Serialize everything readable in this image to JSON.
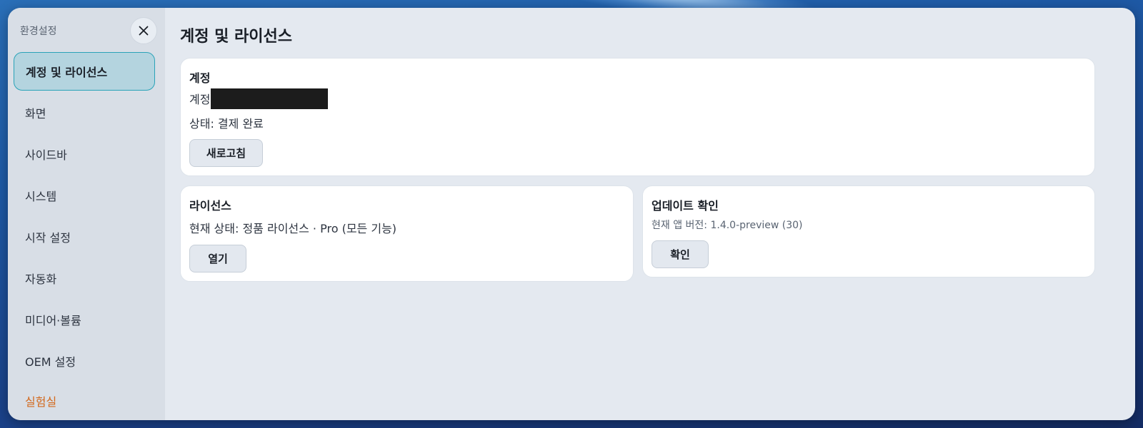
{
  "sidebar": {
    "title": "환경설정",
    "items": [
      {
        "label": "계정 및 라이선스",
        "active": true
      },
      {
        "label": "화면"
      },
      {
        "label": "사이드바"
      },
      {
        "label": "시스템"
      },
      {
        "label": "시작 설정"
      },
      {
        "label": "자동화"
      },
      {
        "label": "미디어·볼륨"
      },
      {
        "label": "OEM 설정"
      },
      {
        "label": "실험실",
        "accent": "#d2691e"
      }
    ]
  },
  "main": {
    "title": "계정 및 라이선스",
    "account": {
      "title": "계정",
      "account_label": "계정",
      "status": "상태: 결제 완료",
      "refresh_button": "새로고침"
    },
    "license": {
      "title": "라이선스",
      "status": "현재 상태: 정품 라이선스 · Pro (모든 기능)",
      "open_button": "열기"
    },
    "update": {
      "title": "업데이트 확인",
      "version": "현재 앱 버전: 1.4.0-preview (30)",
      "check_button": "확인"
    }
  },
  "colors": {
    "active_border": "#2aa3b8",
    "active_bg": "#b4d4df",
    "lab_accent": "#d2691e"
  }
}
